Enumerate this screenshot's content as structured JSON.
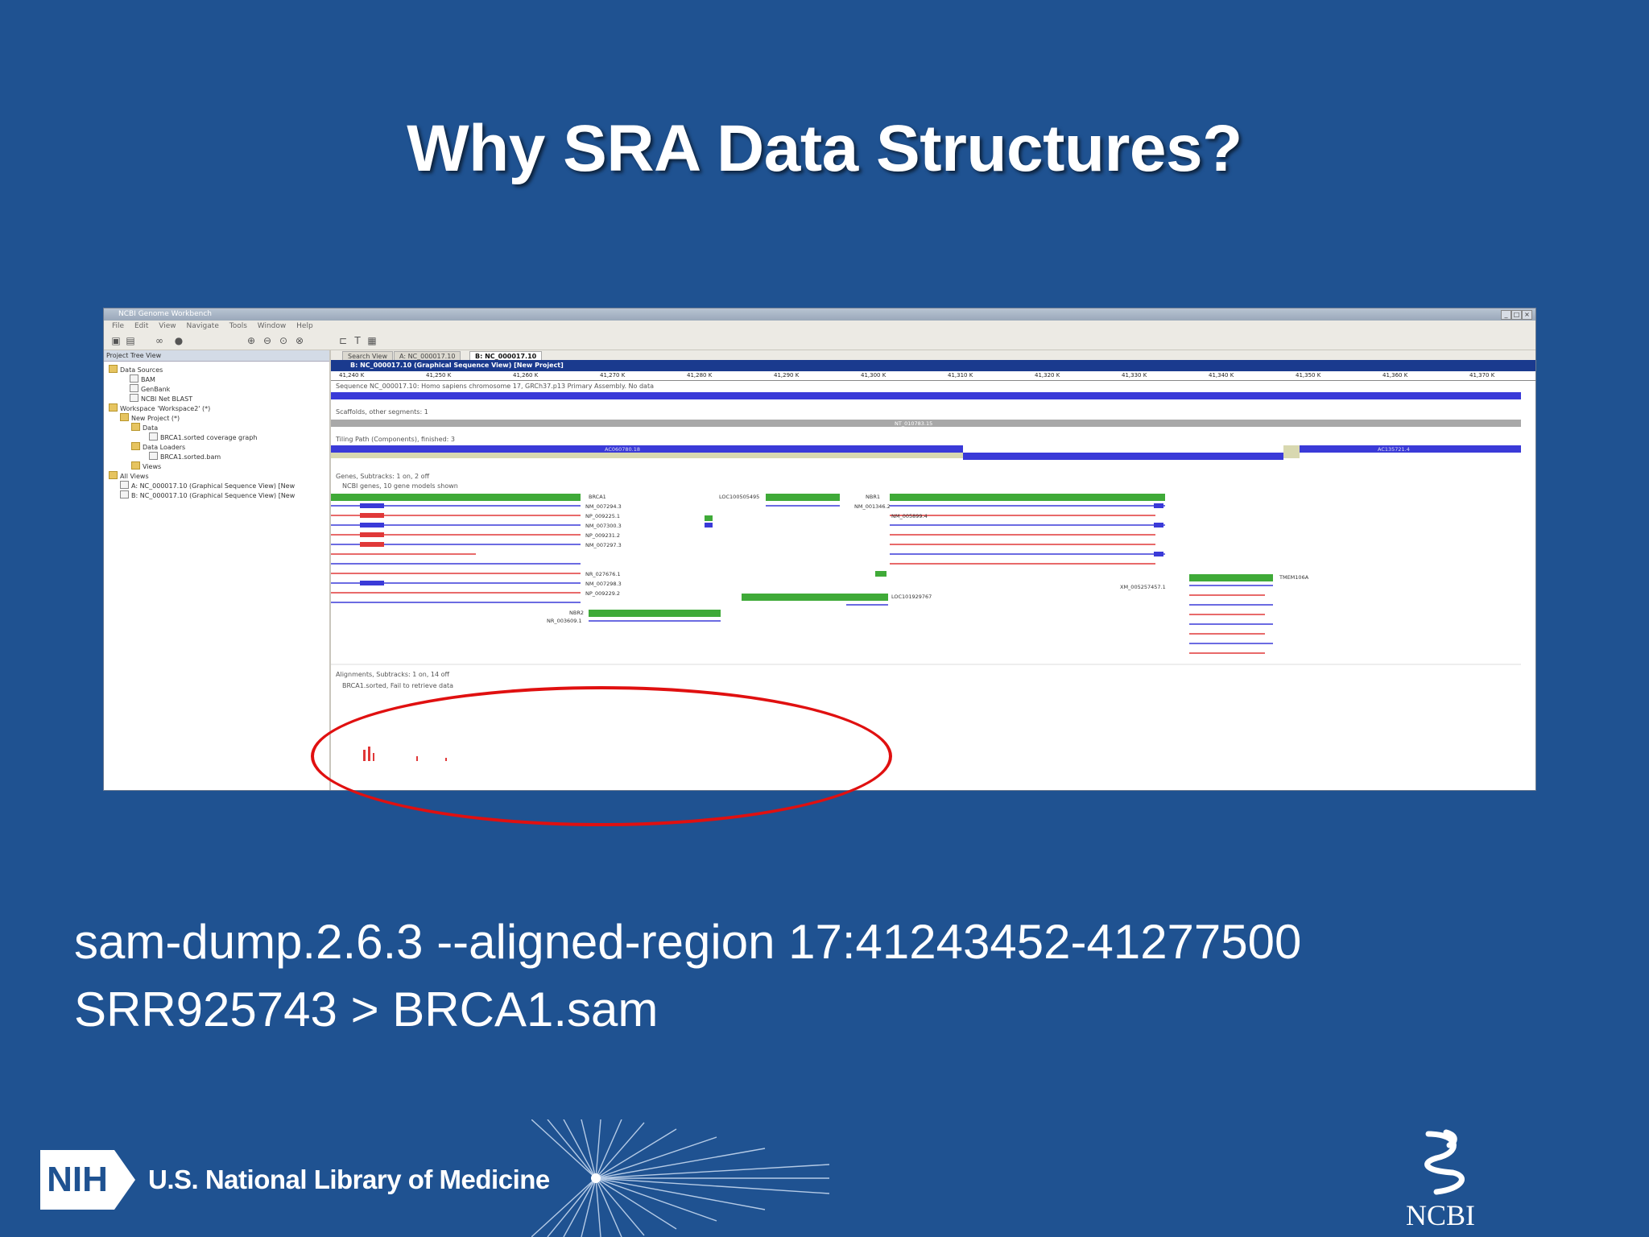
{
  "slide": {
    "title": "Why SRA Data Structures?",
    "command_line1": "sam-dump.2.6.3 --aligned-region 17:41243452-41277500",
    "command_line2": "SRR925743 > BRCA1.sam",
    "footer_org": "U.S. National Library of Medicine",
    "nih_logo": "NIH",
    "ncbi_logo": "NCBI"
  },
  "app": {
    "window_title": "NCBI Genome Workbench",
    "menu": [
      "File",
      "Edit",
      "View",
      "Navigate",
      "Tools",
      "Window",
      "Help"
    ],
    "project_tree": {
      "header": "Project Tree View",
      "nodes": [
        "Data Sources",
        "BAM",
        "GenBank",
        "NCBI Net BLAST",
        "Workspace 'Workspace2' (*)",
        "New Project (*)",
        "Data",
        "BRCA1.sorted coverage graph",
        "Data Loaders",
        "BRCA1.sorted.bam",
        "Views",
        "All Views",
        "A: NC_000017.10 (Graphical Sequence View) [New",
        "B: NC_000017.10 (Graphical Sequence View) [New"
      ]
    },
    "tabs": [
      "Search View",
      "A: NC_000017.10",
      "B: NC_000017.10"
    ],
    "view_title": "B: NC_000017.10 (Graphical Sequence View) [New Project]",
    "ruler_ticks": [
      "41,240 K",
      "41,250 K",
      "41,260 K",
      "41,270 K",
      "41,280 K",
      "41,290 K",
      "41,300 K",
      "41,310 K",
      "41,320 K",
      "41,330 K",
      "41,340 K",
      "41,350 K",
      "41,360 K",
      "41,370 K"
    ],
    "tracks": {
      "sequence": "Sequence NC_000017.10: Homo sapiens chromosome 17, GRCh37.p13 Primary Assembly. No data",
      "scaffolds": "Scaffolds, other segments: 1",
      "scaffold_name": "NT_010783.15",
      "tiling": "Tiling Path (Components), finished: 3",
      "tiling_a": "AC060780.18",
      "tiling_b": "AC135721.4",
      "genes": "Genes, Subtracks: 1 on, 2 off",
      "ncbi_genes": "NCBI genes, 10 gene models shown",
      "alignments": "Alignments, Subtracks: 1 on, 14 off",
      "brca1": "BRCA1.sorted, Fail to retrieve data"
    },
    "gene_labels": [
      "BRCA1",
      "NM_007294.3",
      "NP_009225.1",
      "NM_007300.3",
      "NP_009231.2",
      "NM_007297.3",
      "NR_027676.1",
      "NM_007298.3",
      "NP_009229.2",
      "NBR2",
      "NR_003609.1",
      "LOC100505495",
      "NM_001346.2",
      "LOC101929767",
      "NBR1",
      "NM_005899.4",
      "TMEM106A",
      "XM_005257457.1"
    ],
    "colors": {
      "slide_bg": "#1f5291",
      "highlight_oval": "#e01010",
      "gene_green": "#3faa38",
      "transcript_blue": "#3a3ad8",
      "transcript_red": "#e03838",
      "view_title_bg": "#1a3a8e"
    }
  }
}
